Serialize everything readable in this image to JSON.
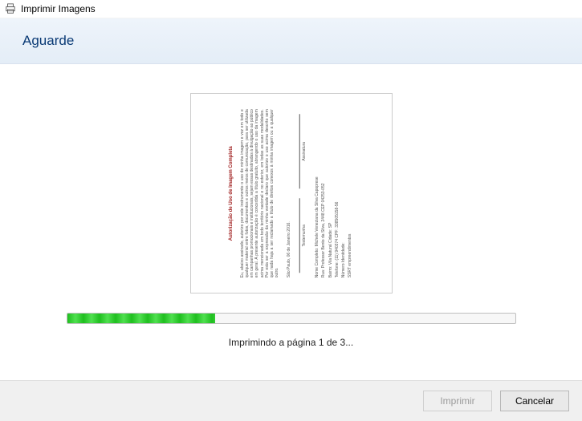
{
  "window": {
    "title": "Imprimir Imagens"
  },
  "header": {
    "title": "Aguarde"
  },
  "preview": {
    "doc_title": "Autorização de Uso de Imagem Completa",
    "doc_body": "Eu, abaixo assinado, autorizo por este instrumento o uso de minha imagem e voz em todo e qualquer material entre fotos, documentos e outros meios de comunicação, para ser utilizada em campanhas promocionais e institucionais, sejam essas destinadas à divulgação ao público em geral. A presente autorização é concedida a título gratuito, abrangendo o uso da imagem acima mencionada em todo território nacional e no exterior, em todas as suas modalidades. Por esta ser a expressão da minha vontade declaro que autorizo o uso acima descrito sem que nada haja a ser reclamado a título de direitos conexos à minha imagem ou a qualquer outro.",
    "doc_date": "São Paulo, 06 de Janeiro 2016.",
    "sig_left": "Testemunha",
    "sig_right": "Assinatura",
    "info_name": "Nome Completo: Michele Veneziana da Silva Capoprese",
    "info_addr": "Rua: Professor Bento da Silva, 2448    CEP 04253-052",
    "info_bairro": "Bairro: Vila Natural                          Cidade: SP",
    "info_tel": "Telefone: (11) 940374    CPF: 338505158-56",
    "info_rg": "Número Identidade:",
    "info_org": "SSRT empreendimentos"
  },
  "progress": {
    "status_text": "Imprimindo a página 1 de 3..."
  },
  "footer": {
    "print_label": "Imprimir",
    "cancel_label": "Cancelar"
  }
}
